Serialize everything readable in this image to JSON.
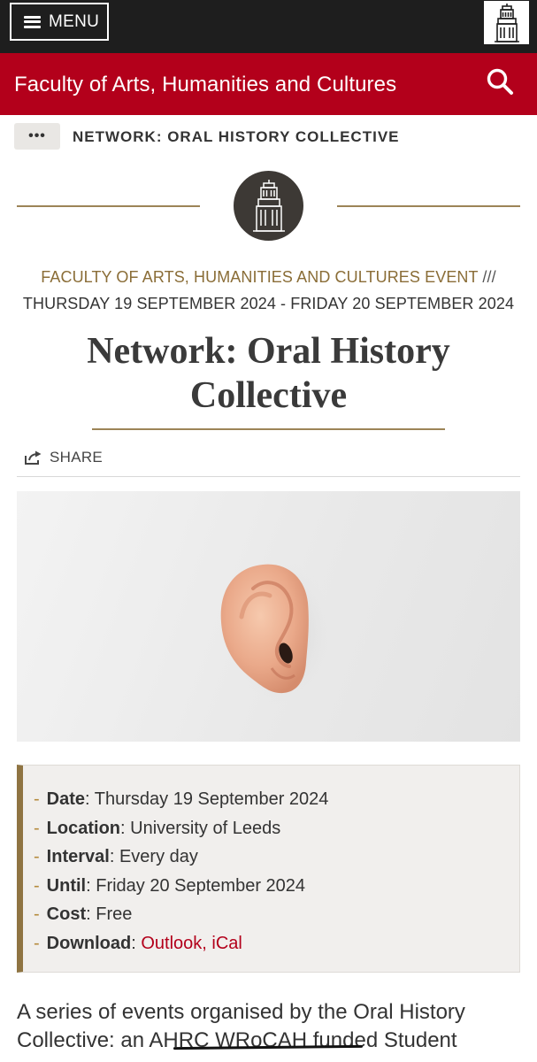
{
  "topbar": {
    "menu_label": "MENU"
  },
  "header": {
    "faculty_title": "Faculty of Arts, Humanities and Cultures"
  },
  "breadcrumb": {
    "ellipsis": "•••",
    "current": "NETWORK: ORAL HISTORY COLLECTIVE"
  },
  "event": {
    "type": "FACULTY OF ARTS, HUMANITIES AND CULTURES EVENT",
    "separator": "///",
    "dates": "THURSDAY 19 SEPTEMBER 2024 - FRIDAY 20 SEPTEMBER 2024",
    "title_line1": "Network: Oral History",
    "title_line2": "Collective"
  },
  "share": {
    "label": "SHARE"
  },
  "details": {
    "date_key": "Date",
    "date_value": "Thursday 19 September 2024",
    "location_key": "Location",
    "location_value": "University of Leeds",
    "interval_key": "Interval",
    "interval_value": "Every day",
    "until_key": "Until",
    "until_value": "Friday 20 September 2024",
    "cost_key": "Cost",
    "cost_value": "Free",
    "download_key": "Download",
    "download_outlook": "Outlook",
    "download_ical": "iCal"
  },
  "body": {
    "line1": "A series of events organised by the Oral History",
    "line2": "Collective: an AHRC WRoCAH funded Student"
  },
  "colors": {
    "brand_red": "#b3001b",
    "gold_rule": "#9c8457",
    "topbar": "#1e1e1e"
  },
  "icons": {
    "menu": "hamburger-icon",
    "logo": "parkinson-tower-logo-icon",
    "search": "search-icon",
    "share": "share-icon"
  }
}
